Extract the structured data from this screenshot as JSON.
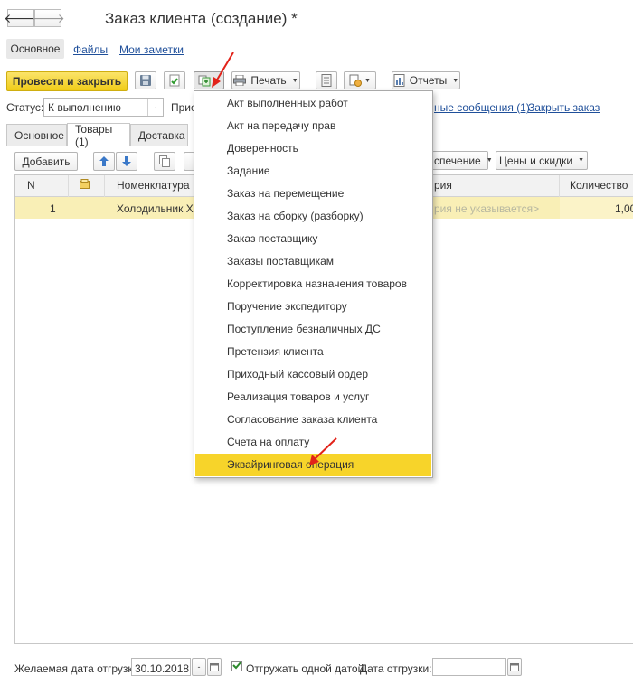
{
  "window": {
    "title": "Заказ клиента (создание) *"
  },
  "nav": {
    "back_glyph": "🡐",
    "forward_glyph": "🡒"
  },
  "top_tabs": {
    "main": "Основное",
    "files": "Файлы",
    "notes": "Мои заметки"
  },
  "toolbar": {
    "post_close": "Провести и закрыть",
    "print": "Печать",
    "reports": "Отчеты",
    "caret": "▼"
  },
  "status": {
    "label": "Статус:",
    "value": "К выполнению",
    "prio_label": "Прио",
    "messages_link": "Электронные сообщения (1)",
    "messages_visible": "ные сообщения (1)",
    "close_order": "Закрыть заказ"
  },
  "doc_tabs": {
    "main": "Основное",
    "goods": "Товары (1)",
    "delivery": "Доставка"
  },
  "table_toolbar": {
    "add": "Добавить",
    "provision_visible": "спечение",
    "prices": "Цены и скидки"
  },
  "table": {
    "headers": {
      "n": "N",
      "nomenclature": "Номенклатура",
      "series_visible": "рия",
      "quantity": "Количество"
    },
    "rows": [
      {
        "n": "1",
        "nomenclature_visible": "Холодильник Х-12",
        "series_visible": "рия не указывается>",
        "quantity": "1,00"
      }
    ]
  },
  "menu": {
    "items": [
      "Акт выполненных работ",
      "Акт на передачу прав",
      "Доверенность",
      "Задание",
      "Заказ на перемещение",
      "Заказ на сборку (разборку)",
      "Заказ поставщику",
      "Заказы поставщикам",
      "Корректировка назначения товаров",
      "Поручение экспедитору",
      "Поступление безналичных ДС",
      "Претензия клиента",
      "Приходный кассовый ордер",
      "Реализация товаров и услуг",
      "Согласование заказа клиента",
      "Счета на оплату",
      "Эквайринговая операция"
    ],
    "selected": "Эквайринговая операция"
  },
  "footer": {
    "desired_date_label": "Желаемая дата отгрузки:",
    "desired_date": "30.10.2018",
    "ship_one_date": "Отгружать одной датой",
    "ship_date_label": "Дата отгрузки:"
  },
  "colors": {
    "accent_yellow": "#f5d11f",
    "selection": "#f7d42a",
    "row_yellow": "#f9efb6",
    "link": "#1f4f9a",
    "arrow_red": "#e2231a"
  }
}
